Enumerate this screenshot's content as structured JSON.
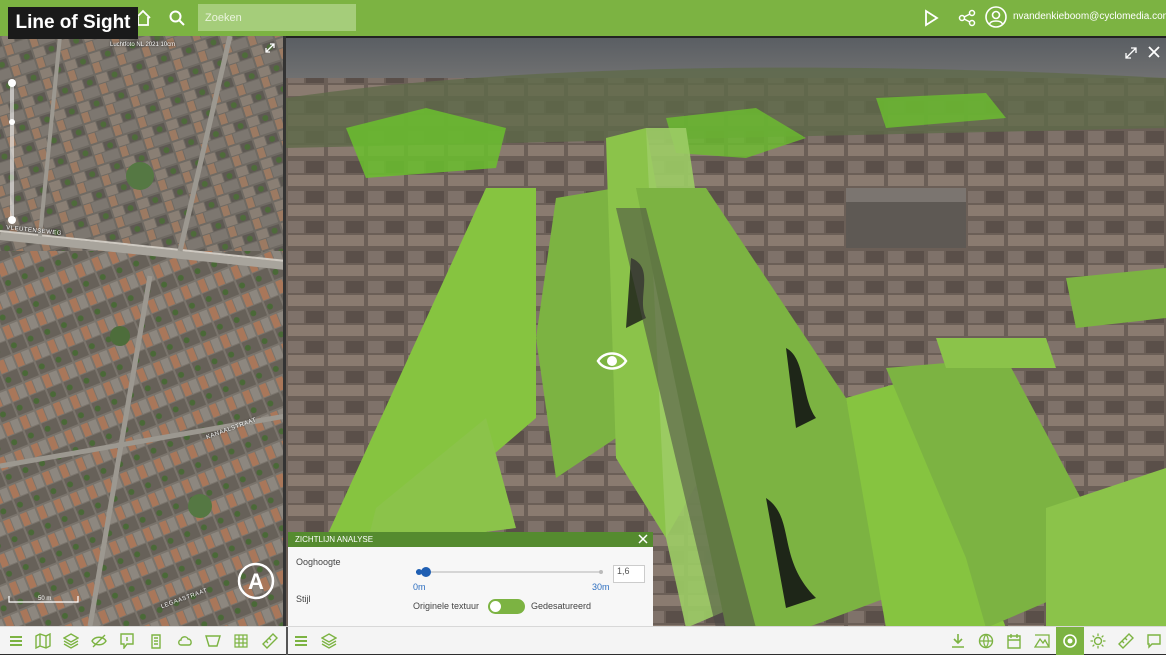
{
  "app": {
    "title": "Line of Sight",
    "search_placeholder": "Zoeken",
    "user_name": "nvandenkieboom@cyclomedia.com",
    "user_caret": "▾",
    "accent_color": "#7cb342",
    "icons": [
      "home-icon",
      "search-icon",
      "play-icon",
      "share-icon",
      "user-icon"
    ]
  },
  "map": {
    "caption": "Luchtfoto NL 2021 10cm",
    "scale_label": "50 m",
    "street_labels": [
      "VLEUTENSEWEG",
      "KANAALSTRAAT",
      "LEGAASTRAAT"
    ],
    "north_arrow_label": "A"
  },
  "dialog": {
    "title": "ZICHTLIJN ANALYSE",
    "eye_height_label": "Ooghoogte",
    "slider_min": "0m",
    "slider_max": "30m",
    "value": "1,6",
    "value_fraction": 0.053,
    "style_label": "Stijl",
    "toggle_left": "Originele textuur",
    "toggle_right": "Gedesatureerd",
    "toggle_on": true
  },
  "toolbar_left": [
    "menu-icon",
    "map-icon",
    "layers-icon",
    "eye-off-icon",
    "annotation-icon",
    "building-icon",
    "cloud-icon",
    "perspective-icon",
    "grid-icon",
    "ruler-icon"
  ],
  "toolbar_right": [
    "menu-icon",
    "layers-icon",
    "download-icon",
    "globe-icon",
    "calendar-icon",
    "terrain-icon",
    "viewshed-icon",
    "sun-icon",
    "ruler-icon",
    "chat-icon"
  ]
}
